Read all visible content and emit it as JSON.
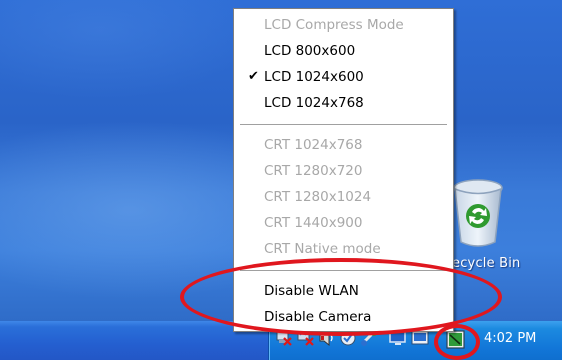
{
  "menu": {
    "items": [
      {
        "label": "LCD Compress Mode",
        "disabled": true,
        "checked": false
      },
      {
        "label": "LCD 800x600",
        "disabled": false,
        "checked": false
      },
      {
        "label": "LCD 1024x600",
        "disabled": false,
        "checked": true
      },
      {
        "label": "LCD 1024x768",
        "disabled": false,
        "checked": false
      },
      {
        "label": "CRT 1024x768",
        "disabled": true,
        "checked": false
      },
      {
        "label": "CRT 1280x720",
        "disabled": true,
        "checked": false
      },
      {
        "label": "CRT 1280x1024",
        "disabled": true,
        "checked": false
      },
      {
        "label": "CRT 1440x900",
        "disabled": true,
        "checked": false
      },
      {
        "label": "CRT Native mode",
        "disabled": true,
        "checked": false
      },
      {
        "label": "Disable WLAN",
        "disabled": false,
        "checked": false
      },
      {
        "label": "Disable Camera",
        "disabled": false,
        "checked": false
      }
    ],
    "check_glyph": "✔"
  },
  "desktop": {
    "recycle_label": "ecycle Bin"
  },
  "taskbar": {
    "clock": "4:02 PM",
    "tray_icons": [
      "network-disconnected-icon",
      "wireless-disconnected-icon",
      "volume-icon",
      "security-icon",
      "connection-icon",
      "monitor-icon",
      "display-mode-icon"
    ]
  },
  "colors": {
    "annotation": "#e0171e",
    "menu_disabled_text": "#a8a8a8"
  }
}
